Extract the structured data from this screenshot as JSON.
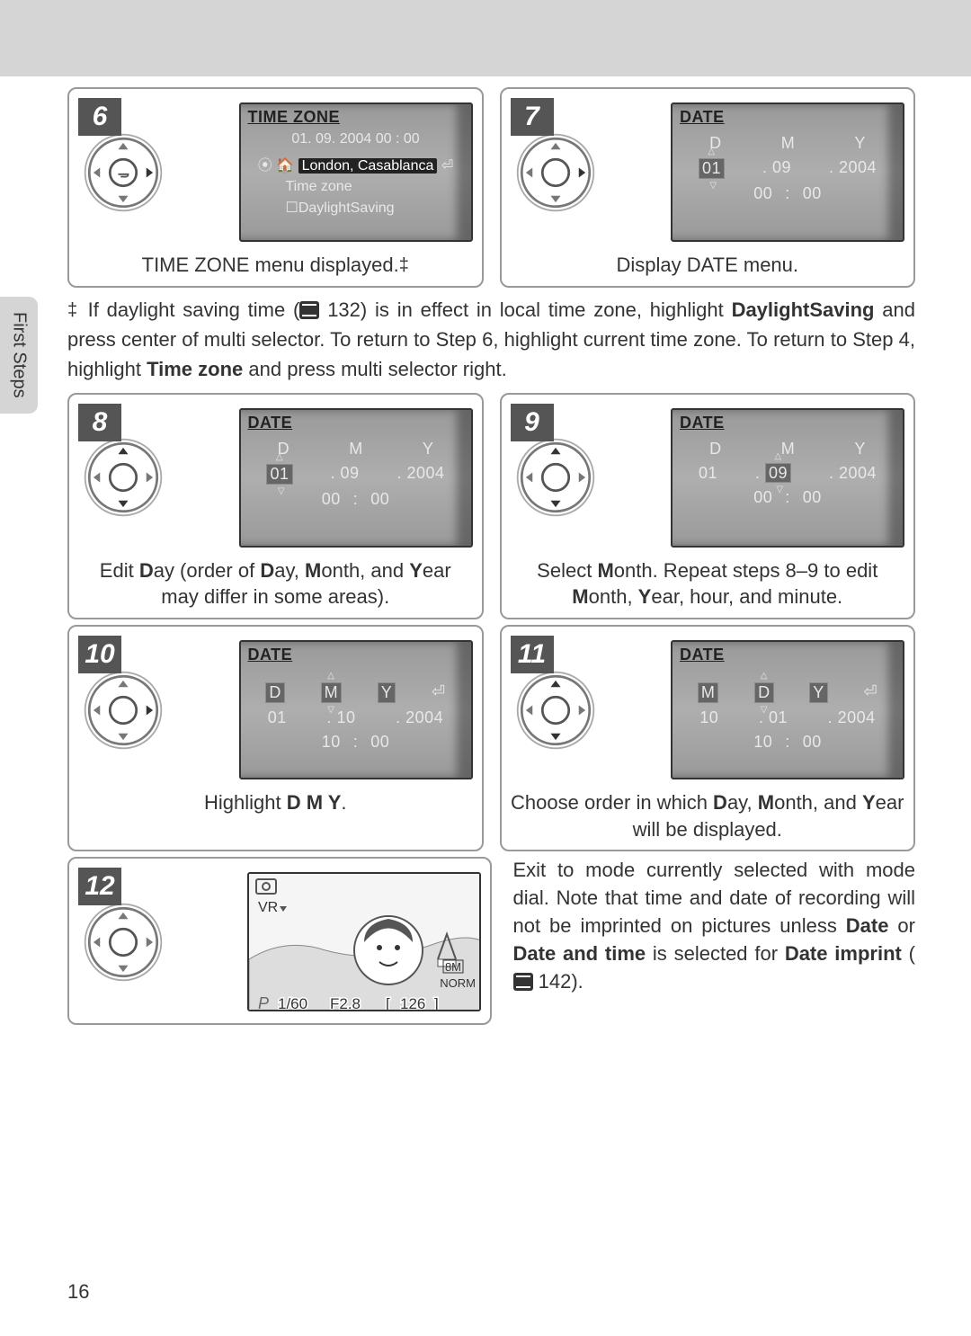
{
  "sidebar": {
    "label": "First Steps"
  },
  "page_number": "16",
  "steps": {
    "s6": {
      "num": "6",
      "lcd": {
        "title": "TIME ZONE",
        "datetime": "01. 09. 2004  00 : 00",
        "loc": "London, Casablanca",
        "tz": "Time zone",
        "ds_box": "☐",
        "ds": "DaylightSaving"
      },
      "caption_a": "TIME ZONE menu displayed.",
      "caption_dagger": "‡"
    },
    "s7": {
      "num": "7",
      "lcd": {
        "title": "DATE",
        "d": "D",
        "m": "M",
        "y": "Y",
        "v1": "01",
        "v2": "09",
        "v3": "2004",
        "h1": "00",
        "h2": "00"
      },
      "caption": "Display DATE menu."
    },
    "s8": {
      "num": "8",
      "lcd": {
        "title": "DATE",
        "d": "D",
        "m": "M",
        "y": "Y",
        "v1": "01",
        "v2": "09",
        "v3": "2004",
        "h1": "00",
        "h2": "00"
      },
      "cap_pre": "Edit ",
      "cap_b1": "D",
      "cap_mid1": "ay (order of ",
      "cap_b2": "D",
      "cap_mid2": "ay, ",
      "cap_b3": "M",
      "cap_mid3": "onth, and ",
      "cap_b4": "Y",
      "cap_post": "ear may differ in some areas)."
    },
    "s9": {
      "num": "9",
      "lcd": {
        "title": "DATE",
        "d": "D",
        "m": "M",
        "y": "Y",
        "v1": "01",
        "v2": "09",
        "v3": "2004",
        "h1": "00",
        "h2": "00"
      },
      "cap_pre": "Select ",
      "cap_b1": "M",
      "cap_mid1": "onth.  Repeat steps 8–9 to edit ",
      "cap_b2": "M",
      "cap_mid2": "onth, ",
      "cap_b3": "Y",
      "cap_post": "ear, hour, and minute."
    },
    "s10": {
      "num": "10",
      "lcd": {
        "title": "DATE",
        "d": "D",
        "m": "M",
        "y": "Y",
        "v1": "01",
        "v2": "10",
        "v3": "2004",
        "h1": "10",
        "h2": "00"
      },
      "cap_pre": "Highlight ",
      "cap_b": "D M Y",
      "cap_post": "."
    },
    "s11": {
      "num": "11",
      "lcd": {
        "title": "DATE",
        "d": "M",
        "m": "D",
        "y": "Y",
        "v1": "10",
        "v2": "01",
        "v3": "2004",
        "h1": "10",
        "h2": "00"
      },
      "cap_pre": "Choose order in which ",
      "cap_b1": "D",
      "cap_mid1": "ay, ",
      "cap_b2": "M",
      "cap_mid2": "onth, and ",
      "cap_b3": "Y",
      "cap_post": "ear will be displayed."
    },
    "s12": {
      "num": "12",
      "photo": {
        "vr": "VR",
        "size": "8M",
        "norm": "NORM",
        "p": "P",
        "shutter": "1/60",
        "f": "F2.8",
        "brL": "[",
        "count": "126",
        "brR": "]"
      },
      "t1": "Exit to mode currently selected with mode dial.  Note that time and date of recording will not be imprinted on pictures unless ",
      "b1": "Date",
      "t2": " or ",
      "b2": "Date and time",
      "t3": " is selected for ",
      "b3": "Date imprint",
      "t4": " (",
      "ref": "142",
      "t5": ")."
    }
  },
  "note": {
    "dagger": "‡",
    "t1": "If daylight saving time (",
    "ref": "132",
    "t2": ") is in effect in local time zone, highlight ",
    "b1": "DaylightSaving",
    "t3": " and press center of multi selector.  To return to Step 6, highlight current time zone.  To return to Step 4, highlight ",
    "b2": "Time zone",
    "t4": " and press multi selector right."
  }
}
